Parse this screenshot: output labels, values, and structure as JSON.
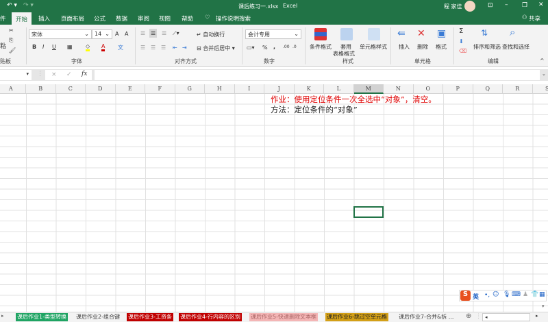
{
  "title": {
    "filename": "课后练习一.xlsx",
    "separator": "-",
    "app": "Excel",
    "user": "程 家佳"
  },
  "tabs": [
    "件",
    "开始",
    "插入",
    "页面布局",
    "公式",
    "数据",
    "审阅",
    "视图",
    "帮助",
    "操作说明搜索"
  ],
  "share": "共享",
  "ribbon": {
    "clipboard": {
      "paste": "粘",
      "group": "贴板"
    },
    "font": {
      "name": "宋体",
      "size": "14",
      "bold": "B",
      "italic": "I",
      "underline": "U",
      "grow": "A",
      "shrink": "A",
      "group": "字体"
    },
    "alignment": {
      "wrap": "自动换行",
      "merge": "合并后居中",
      "group": "对齐方式"
    },
    "number": {
      "format": "会计专用",
      "percent": "%",
      "comma": ",",
      "group": "数字"
    },
    "styles": {
      "conditional": "条件格式",
      "table": "套用",
      "table2": "表格格式",
      "cell": "单元格样式",
      "group": "样式"
    },
    "cells": {
      "insert": "插入",
      "delete": "删除",
      "format": "格式",
      "group": "单元格"
    },
    "editing": {
      "sum": "Σ",
      "sort": "排序和筛选",
      "find": "查找和选择",
      "group": "编辑"
    }
  },
  "formula": {
    "fx": "fx",
    "cancel": "×",
    "enter": "✓",
    "value": ""
  },
  "columns": [
    "A",
    "B",
    "C",
    "D",
    "E",
    "F",
    "G",
    "H",
    "I",
    "J",
    "K",
    "L",
    "M",
    "N",
    "O",
    "P",
    "Q",
    "R",
    "S"
  ],
  "cells": {
    "task": "作业：使用定位条件一次全选中“对象”，清空。",
    "method": "方法：定位条件的“对象”"
  },
  "ime": {
    "lang": "英"
  },
  "sheets": [
    {
      "label": "课后作业1-类型转换",
      "color": "#1fa463"
    },
    {
      "label": "课后作业2-组合键",
      "color": ""
    },
    {
      "label": "课后作业3-工资条",
      "color": "#c00000"
    },
    {
      "label": "课后作业4-行内容的区别",
      "color": "#c00000"
    },
    {
      "label": "课后作业5-快速删除文本框",
      "color": "#f4b6b6"
    },
    {
      "label": "课后作业6-跳过空单元格",
      "color": "#d4a017"
    },
    {
      "label": "课后作业7-合并&拆 ...",
      "color": ""
    }
  ],
  "colors": {
    "brand": "#217346",
    "task_text": "#e00000"
  }
}
